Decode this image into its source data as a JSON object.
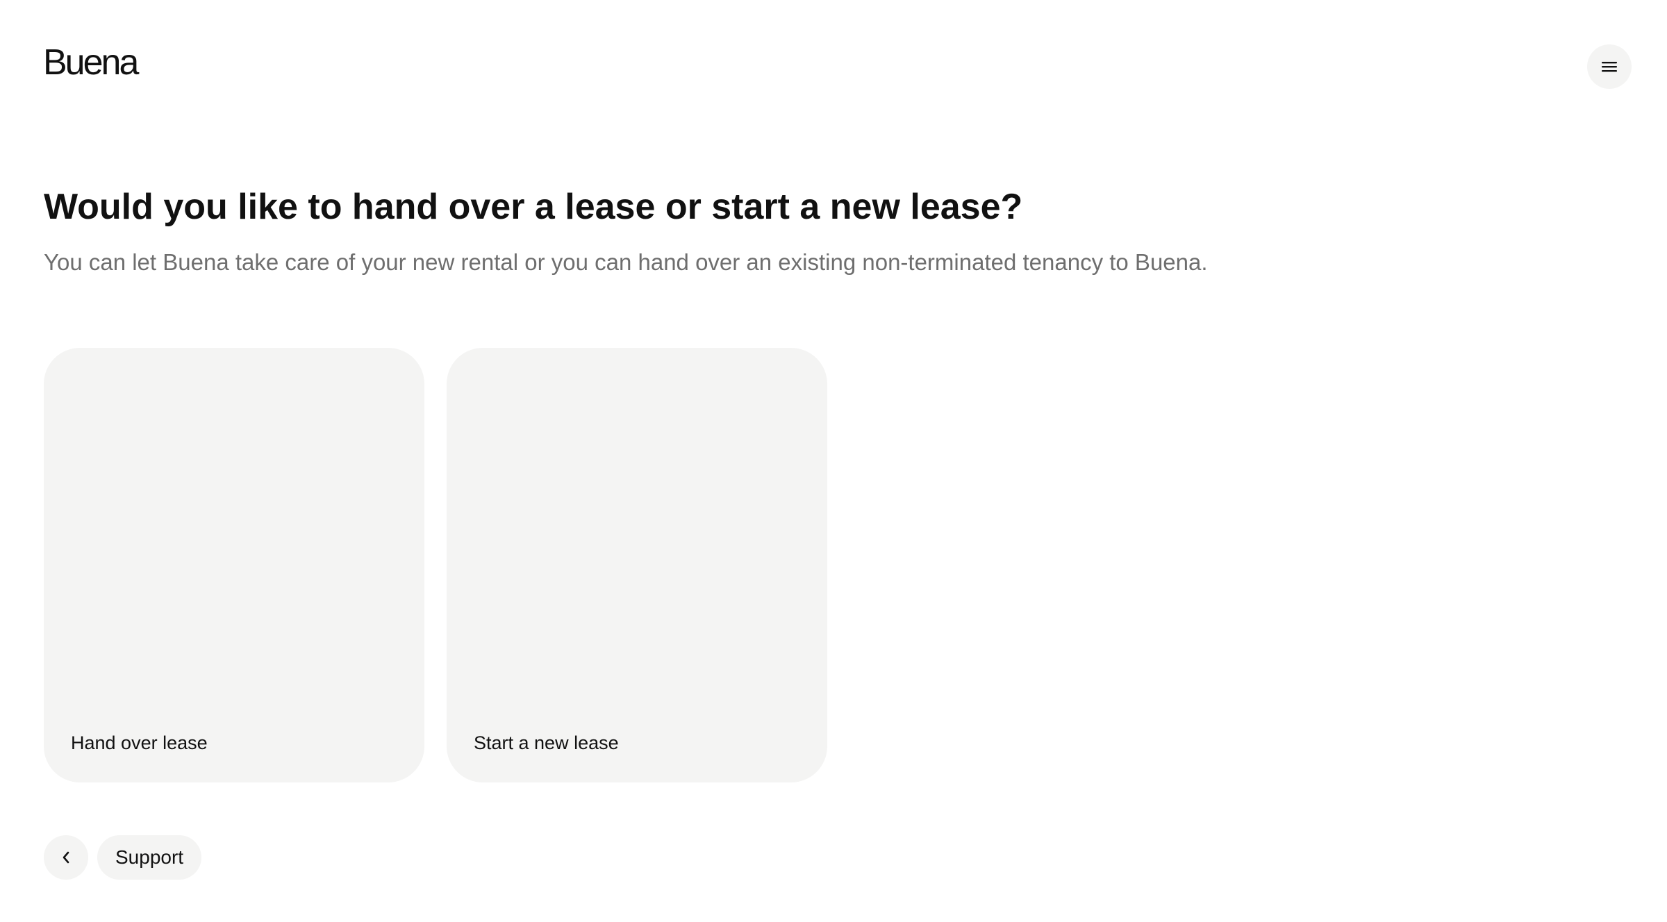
{
  "header": {
    "logo_text": "Buena",
    "menu_icon": "hamburger-menu-icon"
  },
  "main": {
    "title": "Would you like to hand over a lease or start a new lease?",
    "subtitle": "You can let Buena take care of your new rental or you can hand over an existing non-terminated tenancy to Buena.",
    "options": [
      {
        "label": "Hand over lease"
      },
      {
        "label": "Start a new lease"
      }
    ]
  },
  "footer": {
    "back_icon": "chevron-left-icon",
    "support_label": "Support"
  },
  "colors": {
    "card_background": "#f4f4f3",
    "title_text": "#111111",
    "subtitle_text": "#6e6e6e"
  }
}
